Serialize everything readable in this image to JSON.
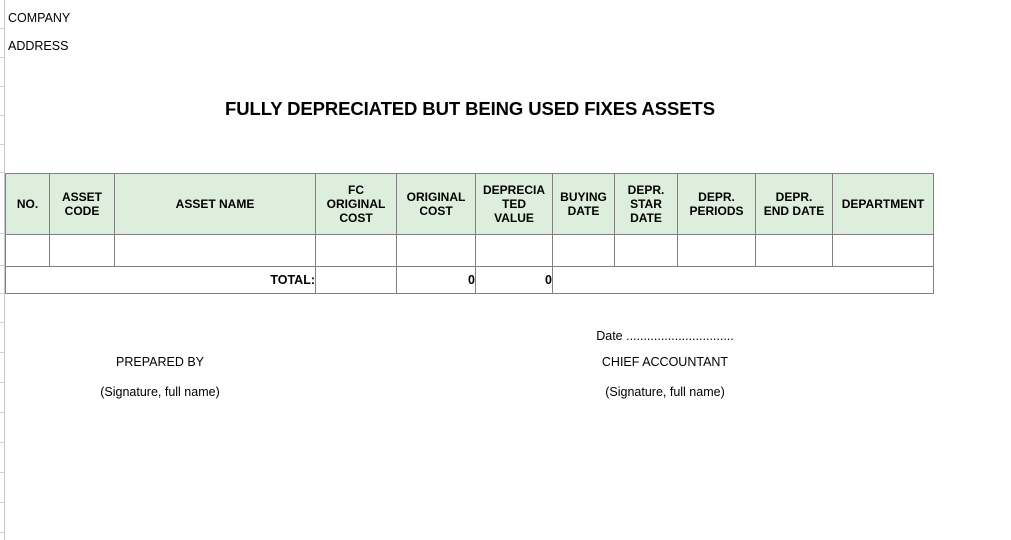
{
  "document": {
    "company_label": "COMPANY",
    "address_label": "ADDRESS",
    "title": "FULLY DEPRECIATED BUT BEING USED FIXES ASSETS"
  },
  "colors": {
    "header_fill": "#ddeedd",
    "grid_line": "#808080",
    "selection_marker": "#1a7a43"
  },
  "table": {
    "columns": [
      {
        "key": "no",
        "label": "NO."
      },
      {
        "key": "code",
        "label": "ASSET\nCODE"
      },
      {
        "key": "name",
        "label": "ASSET NAME"
      },
      {
        "key": "fc",
        "label": "FC\nORIGINAL\nCOST"
      },
      {
        "key": "oc",
        "label": "ORIGINAL\nCOST"
      },
      {
        "key": "dv",
        "label": "DEPRECIA\nTED\nVALUE"
      },
      {
        "key": "bd",
        "label": "BUYING\nDATE"
      },
      {
        "key": "dsd",
        "label": "DEPR.\nSTAR\nDATE"
      },
      {
        "key": "dp",
        "label": "DEPR.\nPERIODS"
      },
      {
        "key": "ded",
        "label": "DEPR.\nEND DATE"
      },
      {
        "key": "dept",
        "label": "DEPARTMENT"
      }
    ],
    "header_lines": {
      "no": [
        "NO."
      ],
      "code": [
        "ASSET",
        "CODE"
      ],
      "name": [
        "ASSET NAME"
      ],
      "fc": [
        "FC",
        "ORIGINAL",
        "COST"
      ],
      "oc": [
        "ORIGINAL",
        "COST"
      ],
      "dv": [
        "DEPRECIA",
        "TED",
        "VALUE"
      ],
      "bd": [
        "BUYING",
        "DATE"
      ],
      "dsd": [
        "DEPR.",
        "STAR",
        "DATE"
      ],
      "dp": [
        "DEPR.",
        "PERIODS"
      ],
      "ded": [
        "DEPR.",
        "END DATE"
      ],
      "dept": [
        "DEPARTMENT"
      ]
    },
    "blank_row": {
      "no": "",
      "code": "",
      "name": "",
      "fc": "",
      "oc": "",
      "dv": "",
      "bd": "",
      "dsd": "",
      "dp": "",
      "ded": "",
      "dept": ""
    },
    "total_row": {
      "label": "TOTAL:",
      "fc": "",
      "original_cost": "0",
      "depreciated_value": "0",
      "rest": ""
    }
  },
  "footer": {
    "left": {
      "role": "PREPARED BY",
      "note": "(Signature, full name)"
    },
    "right": {
      "date": "Date ...............................",
      "role": "CHIEF ACCOUNTANT",
      "note": "(Signature, full name)"
    }
  }
}
